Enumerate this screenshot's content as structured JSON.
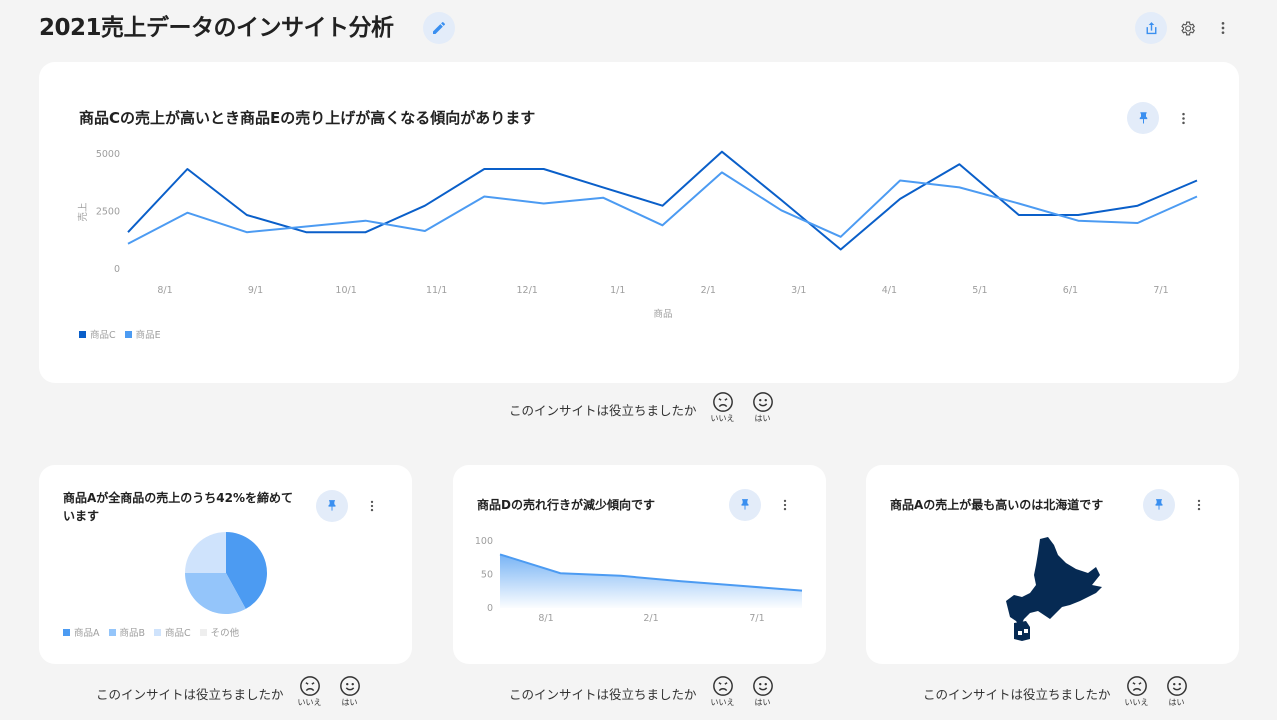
{
  "header": {
    "title": "2021売上データのインサイト分析",
    "edit_icon": "pencil-icon",
    "share_icon": "share-icon",
    "settings_icon": "gear-icon",
    "more_icon": "more-vert-icon"
  },
  "colors": {
    "accent": "#3a8ff0",
    "series_dark": "#0a5fc9",
    "series_light": "#4c9bf2",
    "map": "#062a53"
  },
  "feedback": {
    "question": "このインサイトは役立ちましたか",
    "no": "いいえ",
    "yes": "はい"
  },
  "main_card": {
    "title": "商品Cの売上が高いとき商品Eの売り上げが高くなる傾向があります",
    "chart_data": {
      "type": "line",
      "xlabel": "商品",
      "ylabel": "売上",
      "ylim": [
        0,
        5000
      ],
      "yticks": [
        "5000",
        "2500",
        "0"
      ],
      "x_tick_labels": [
        "8/1",
        "9/1",
        "10/1",
        "11/1",
        "12/1",
        "1/1",
        "2/1",
        "3/1",
        "4/1",
        "5/1",
        "6/1",
        "7/1"
      ],
      "x": [
        "7/15",
        "8/15",
        "9/15",
        "10/1",
        "10/15",
        "11/15",
        "12/15",
        "1/15",
        "2/15",
        "3/1",
        "3/15",
        "4/1",
        "4/15",
        "5/1",
        "5/15",
        "6/1",
        "6/15",
        "7/1",
        "7/15"
      ],
      "series": [
        {
          "name": "商品C",
          "color": "#0a5fc9",
          "values": [
            1600,
            4350,
            2350,
            1600,
            1600,
            2750,
            4350,
            4350,
            3550,
            2750,
            5100,
            3000,
            850,
            3050,
            4550,
            2350,
            2350,
            2750,
            3850
          ]
        },
        {
          "name": "商品E",
          "color": "#4c9bf2",
          "values": [
            1100,
            2450,
            1600,
            1850,
            2100,
            1650,
            3150,
            2850,
            3100,
            1900,
            4200,
            2550,
            1400,
            3850,
            3550,
            2850,
            2100,
            2000,
            3150
          ]
        }
      ],
      "legend": "bottom-left"
    }
  },
  "card_pie": {
    "title": "商品Aが全商品の売上のうち42%を締めています",
    "chart_data": {
      "type": "pie",
      "categories": [
        "商品A",
        "商品B",
        "商品C",
        "その他"
      ],
      "values": [
        42,
        33,
        25,
        0
      ],
      "colors": [
        "#4c9bf2",
        "#94c5fa",
        "#cfe3fc",
        "#eeeeee"
      ]
    }
  },
  "card_area": {
    "title": "商品Dの売れ行きが減少傾向です",
    "chart_data": {
      "type": "area",
      "ylim": [
        0,
        100
      ],
      "yticks": [
        "100",
        "50",
        "0"
      ],
      "x_tick_labels": [
        "8/1",
        "2/1",
        "7/1"
      ],
      "series": [
        {
          "values": [
            80,
            52,
            48,
            40,
            33,
            26
          ]
        }
      ]
    }
  },
  "card_map": {
    "title": "商品Aの売上が最も高いのは北海道です",
    "map_region": "北海道"
  }
}
